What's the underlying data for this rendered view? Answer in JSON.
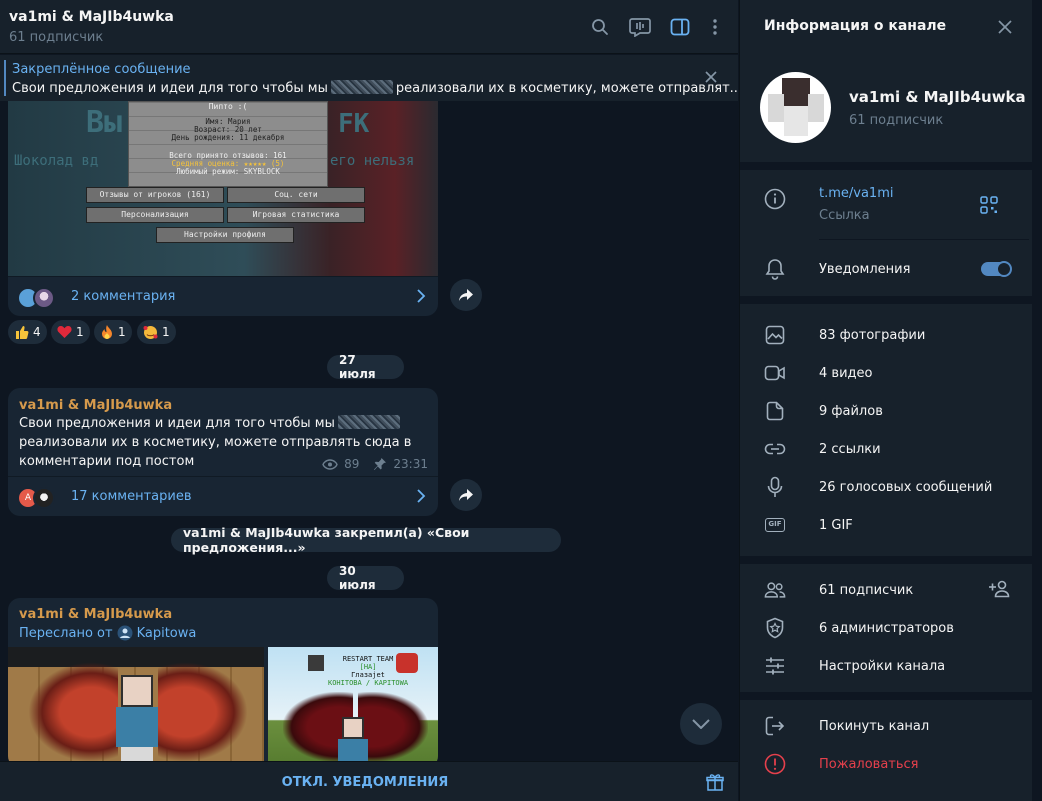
{
  "chat": {
    "title": "va1mi & MaJIb4uwka",
    "subtitle": "61 подписчик"
  },
  "pinned": {
    "label": "Закреплённое сообщение",
    "text_before": "Свои предложения и идеи для того чтобы мы",
    "text_after": "реализовали их в косметику, можете отправлят..."
  },
  "minecraft_menu": {
    "heading_left": "Вы",
    "heading_right": "FK",
    "line2": "Шоколад вд",
    "line2_right": "его нельзя",
    "profile_name": "Пипто :(",
    "info_lines": [
      "Имя: Мария",
      "Возраст: 20 лет",
      "День рождения: 11 декабря"
    ],
    "stats_lines": [
      "Всего принято отзывов: 161",
      "Средняя оценка: ★★★★★ (5)",
      "Любимый режим: SKYBLOCK"
    ],
    "buttons": [
      "Отзывы от игроков (161)",
      "Соц. сети",
      "Персонализация",
      "Игровая статистика",
      "Настройки профиля"
    ]
  },
  "message1": {
    "comments": "2 комментария",
    "reactions": [
      {
        "emoji": "👍",
        "count": "4",
        "color": "#f5c33b"
      },
      {
        "emoji": "❤",
        "count": "1",
        "color": "#e0293b"
      },
      {
        "emoji": "🔥",
        "count": "1",
        "color": "#f5862b"
      },
      {
        "emoji": "🥰",
        "count": "1",
        "color": "#f5a623"
      }
    ]
  },
  "date1": "27 июля",
  "message2": {
    "author": "va1mi & MaJIb4uwka",
    "line1": "Свои предложения и идеи для того чтобы мы",
    "line2": "реализовали их в косметику, можете отправлять сюда в",
    "line3": "комментарии под постом",
    "views": "89",
    "time": "23:31",
    "comments": "17 комментариев",
    "avatar_letter": "A"
  },
  "service_msg": "va1mi & MaJIb4uwka закрепил(а) «Свои предложения...»",
  "date2": "30 июля",
  "message3": {
    "author": "va1mi & MaJIb4uwka",
    "forwarded": "Переслано от",
    "forward_from": "Kapitowa",
    "image2_text": [
      "RESTART TEAM",
      "[HA]",
      "Глазаjet",
      "KOHITOBA / KAPITOWA"
    ]
  },
  "bottom": {
    "mute_label": "ОТКЛ. УВЕДОМЛЕНИЯ"
  },
  "info": {
    "title": "Информация о канале",
    "channel_name": "va1mi & MaJIb4uwka",
    "subscribers": "61 подписчик",
    "link": "t.me/va1mi",
    "link_label": "Ссылка",
    "notifications": "Уведомления",
    "notifications_on": true,
    "media": [
      {
        "icon": "photo-icon",
        "label": "83 фотографии"
      },
      {
        "icon": "video-icon",
        "label": "4 видео"
      },
      {
        "icon": "file-icon",
        "label": "9 файлов"
      },
      {
        "icon": "link-icon",
        "label": "2 ссылки"
      },
      {
        "icon": "mic-icon",
        "label": "26 голосовых сообщений"
      },
      {
        "icon": "gif-icon",
        "label": "1 GIF"
      }
    ],
    "members": "61 подписчик",
    "admins": "6 администраторов",
    "settings": "Настройки канала",
    "leave": "Покинуть канал",
    "report": "Пожаловаться",
    "gif_badge": "GIF"
  },
  "colors": {
    "accent": "#6ab2f2",
    "author": "#d69a4c",
    "danger": "#e5404c",
    "bg": "#0e1621",
    "panel": "#17212b",
    "bubble": "#182533"
  }
}
